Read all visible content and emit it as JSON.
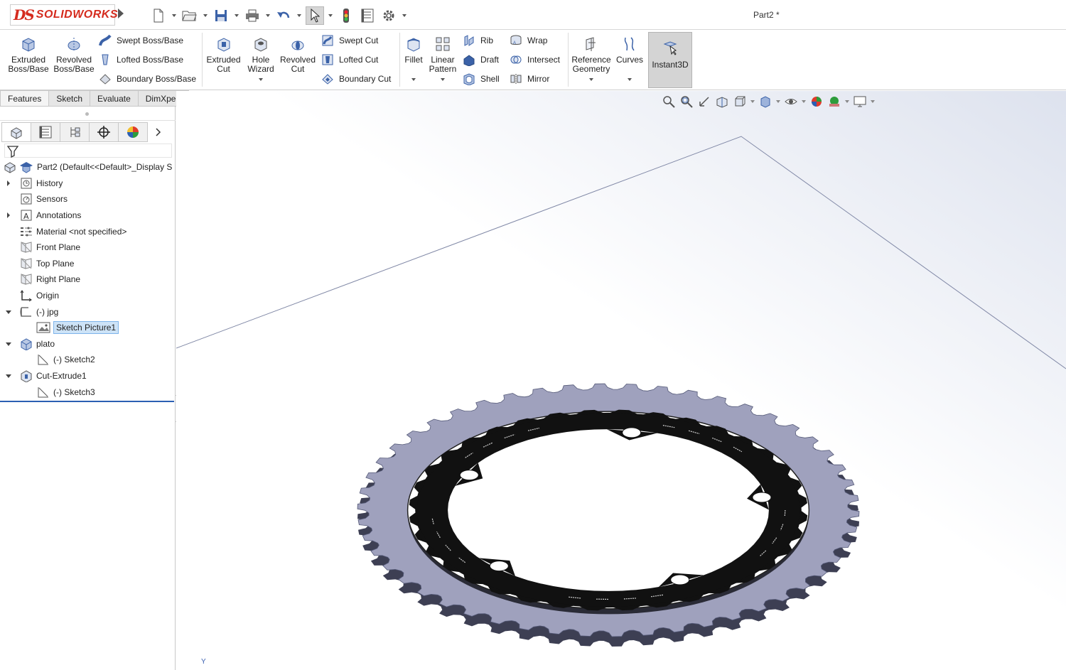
{
  "app": {
    "brand_ds": "DS",
    "brand_name": "SOLIDWORKS",
    "document_title": "Part2 *"
  },
  "colors": {
    "accent_blue": "#2b5fb3",
    "brand_red": "#d52b1e",
    "gear_body": "#9fa1bd",
    "selection_bg": "#cde3f7"
  },
  "ribbon": {
    "extruded_boss": "Extruded Boss/Base",
    "revolved_boss": "Revolved Boss/Base",
    "swept_boss": "Swept Boss/Base",
    "lofted_boss": "Lofted Boss/Base",
    "boundary_boss": "Boundary Boss/Base",
    "extruded_cut": "Extruded Cut",
    "hole_wizard": "Hole Wizard",
    "revolved_cut": "Revolved Cut",
    "swept_cut": "Swept Cut",
    "lofted_cut": "Lofted Cut",
    "boundary_cut": "Boundary Cut",
    "fillet": "Fillet",
    "linear_pattern": "Linear Pattern",
    "rib": "Rib",
    "draft": "Draft",
    "shell": "Shell",
    "wrap": "Wrap",
    "intersect": "Intersect",
    "mirror": "Mirror",
    "reference_geometry": "Reference Geometry",
    "curves": "Curves",
    "instant3d": "Instant3D"
  },
  "tabs": [
    {
      "label": "Features",
      "active": true
    },
    {
      "label": "Sketch",
      "active": false
    },
    {
      "label": "Evaluate",
      "active": false
    },
    {
      "label": "DimXpert",
      "active": false
    }
  ],
  "tree": {
    "root": "Part2  (Default<<Default>_Display S",
    "items": [
      {
        "label": "History",
        "icon": "history-icon",
        "expander": "collapsed"
      },
      {
        "label": "Sensors",
        "icon": "sensors-icon",
        "expander": "none"
      },
      {
        "label": "Annotations",
        "icon": "annotations-icon",
        "expander": "collapsed"
      },
      {
        "label": "Material <not specified>",
        "icon": "material-icon",
        "expander": "none"
      },
      {
        "label": "Front Plane",
        "icon": "plane-icon",
        "expander": "none"
      },
      {
        "label": "Top Plane",
        "icon": "plane-icon",
        "expander": "none"
      },
      {
        "label": "Right Plane",
        "icon": "plane-icon",
        "expander": "none"
      },
      {
        "label": "Origin",
        "icon": "origin-icon",
        "expander": "none"
      },
      {
        "label": "(-) jpg",
        "icon": "sketch-folder-icon",
        "expander": "expanded"
      },
      {
        "label": "Sketch Picture1",
        "icon": "sketch-picture-icon",
        "expander": "none",
        "child": true,
        "selected": true
      },
      {
        "label": "plato",
        "icon": "extrude-feature-icon",
        "expander": "expanded"
      },
      {
        "label": "(-) Sketch2",
        "icon": "sketch-icon",
        "expander": "none",
        "child": true
      },
      {
        "label": "Cut-Extrude1",
        "icon": "cut-extrude-icon",
        "expander": "expanded"
      },
      {
        "label": "(-) Sketch3",
        "icon": "sketch-icon",
        "expander": "none",
        "child": true
      }
    ]
  },
  "viewport": {
    "axis_label": "Y",
    "chainring_teeth": 50,
    "spider_arms": 5
  }
}
